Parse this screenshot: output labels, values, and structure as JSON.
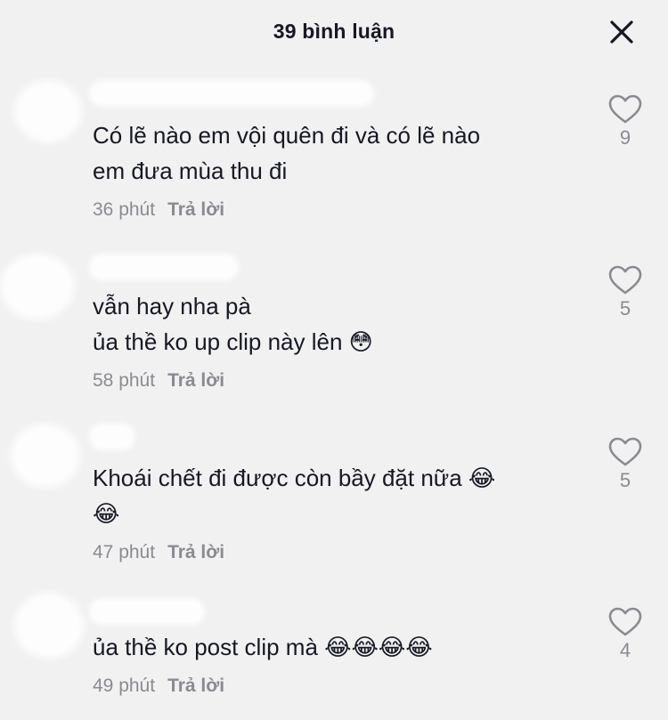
{
  "header": {
    "title": "39 bình luận",
    "close_icon": "close-icon"
  },
  "comments": [
    {
      "text": "Có lẽ nào em vội quên đi và có lẽ nào\nem đưa mùa thu đi",
      "time": "36 phút",
      "reply_label": "Trả lời",
      "likes": "9"
    },
    {
      "text": "vẫn hay nha pà\nủa thề ko up clip này lên 😳",
      "time": "58 phút",
      "reply_label": "Trả lời",
      "likes": "5"
    },
    {
      "text": "Khoái chết đi được còn bầy đặt nữa 😂\n😂",
      "time": "47 phút",
      "reply_label": "Trả lời",
      "likes": "5"
    },
    {
      "text": "ủa thề ko post clip mà 😂😂😂😂",
      "time": "49 phút",
      "reply_label": "Trả lời",
      "likes": "4"
    }
  ],
  "colors": {
    "background": "#f1f1f2",
    "text": "#161823",
    "secondary": "#8a8b91"
  }
}
